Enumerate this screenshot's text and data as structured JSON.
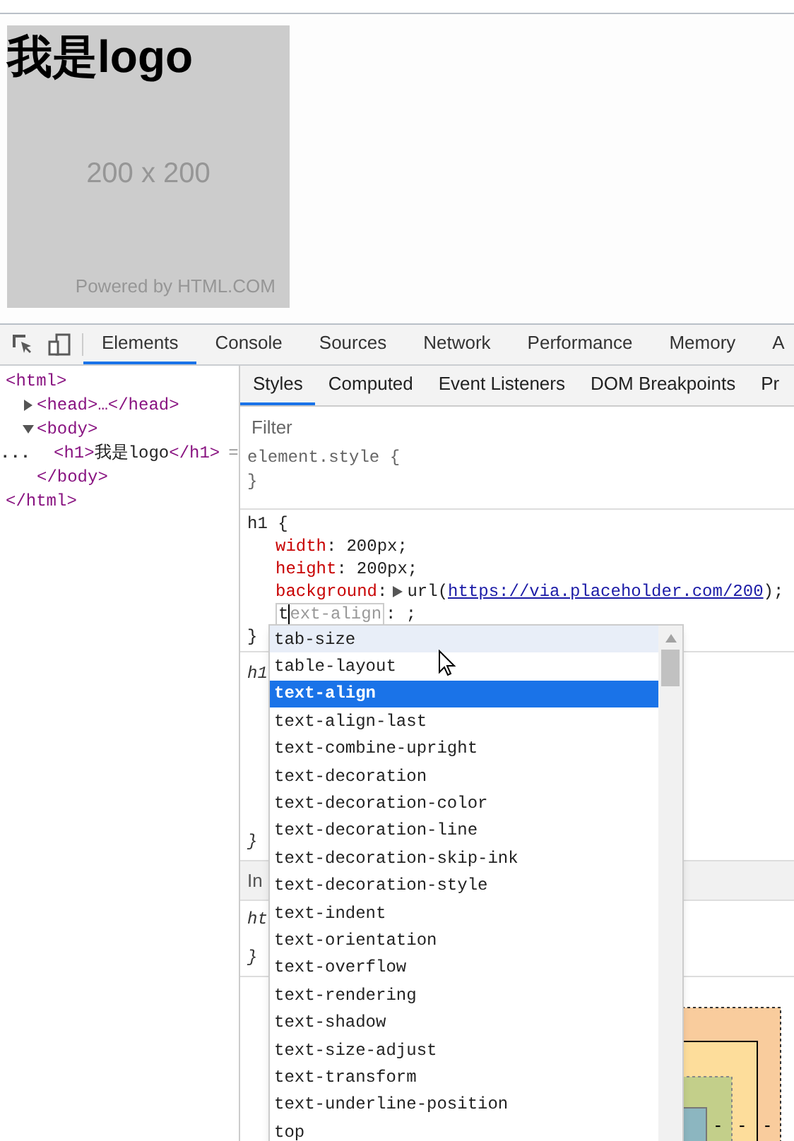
{
  "page": {
    "heading": "我是logo",
    "image_label": "200 x 200",
    "image_credit": "Powered by HTML.COM"
  },
  "devtools": {
    "tabs": [
      {
        "label": "Elements",
        "selected": true
      },
      {
        "label": "Console",
        "selected": false
      },
      {
        "label": "Sources",
        "selected": false
      },
      {
        "label": "Network",
        "selected": false
      },
      {
        "label": "Performance",
        "selected": false
      },
      {
        "label": "Memory",
        "selected": false
      },
      {
        "label": "A",
        "selected": false
      }
    ],
    "dom_tree": [
      {
        "open": "<html>",
        "close": "</html>",
        "children": [
          {
            "text": "<head>…</head>",
            "expanded": false
          },
          {
            "open": "<body>",
            "close": "</body>",
            "expanded": true,
            "children": [
              {
                "open": "<h1>",
                "text": "我是logo",
                "close": "</h1>",
                "gutter": "...",
                "after": "="
              }
            ]
          }
        ]
      }
    ],
    "styles_tabs": [
      {
        "label": "Styles",
        "selected": true
      },
      {
        "label": "Computed",
        "selected": false
      },
      {
        "label": "Event Listeners",
        "selected": false
      },
      {
        "label": "DOM Breakpoints",
        "selected": false
      },
      {
        "label": "Pr",
        "selected": false
      }
    ],
    "filter": {
      "placeholder": "Filter"
    },
    "element_style": {
      "open": "element.style {",
      "close": "}"
    },
    "h1_rule": {
      "open": "h1 {",
      "close": "}",
      "declarations": [
        {
          "property": "width",
          "colon": ":",
          "value": "200px;"
        },
        {
          "property": "height",
          "colon": ":",
          "value": "200px;"
        },
        {
          "property": "background",
          "colon": ":",
          "value_prefix": "url(",
          "link": "https://via.placeholder.com/200",
          "value_suffix": ");"
        }
      ],
      "editing": {
        "typed": "t",
        "suggestion": "ext-align",
        "rest": ": ;"
      }
    },
    "ua_rule": {
      "selector": "h1",
      "close": "}"
    },
    "inherited": {
      "label": "In"
    },
    "html_rule": {
      "selector": "ht",
      "close": "}"
    },
    "box_model": {
      "dashes": [
        "-",
        "-",
        "-"
      ]
    },
    "autocomplete": [
      {
        "label": "tab-size",
        "selected": false,
        "hovered": true
      },
      {
        "label": "table-layout",
        "selected": false,
        "hovered": false
      },
      {
        "label": "text-align",
        "selected": true,
        "hovered": false
      },
      {
        "label": "text-align-last",
        "selected": false,
        "hovered": false
      },
      {
        "label": "text-combine-upright",
        "selected": false,
        "hovered": false
      },
      {
        "label": "text-decoration",
        "selected": false,
        "hovered": false
      },
      {
        "label": "text-decoration-color",
        "selected": false,
        "hovered": false
      },
      {
        "label": "text-decoration-line",
        "selected": false,
        "hovered": false
      },
      {
        "label": "text-decoration-skip-ink",
        "selected": false,
        "hovered": false
      },
      {
        "label": "text-decoration-style",
        "selected": false,
        "hovered": false
      },
      {
        "label": "text-indent",
        "selected": false,
        "hovered": false
      },
      {
        "label": "text-orientation",
        "selected": false,
        "hovered": false
      },
      {
        "label": "text-overflow",
        "selected": false,
        "hovered": false
      },
      {
        "label": "text-rendering",
        "selected": false,
        "hovered": false
      },
      {
        "label": "text-shadow",
        "selected": false,
        "hovered": false
      },
      {
        "label": "text-size-adjust",
        "selected": false,
        "hovered": false
      },
      {
        "label": "text-transform",
        "selected": false,
        "hovered": false
      },
      {
        "label": "text-underline-position",
        "selected": false,
        "hovered": false
      },
      {
        "label": "top",
        "selected": false,
        "hovered": false
      }
    ]
  }
}
